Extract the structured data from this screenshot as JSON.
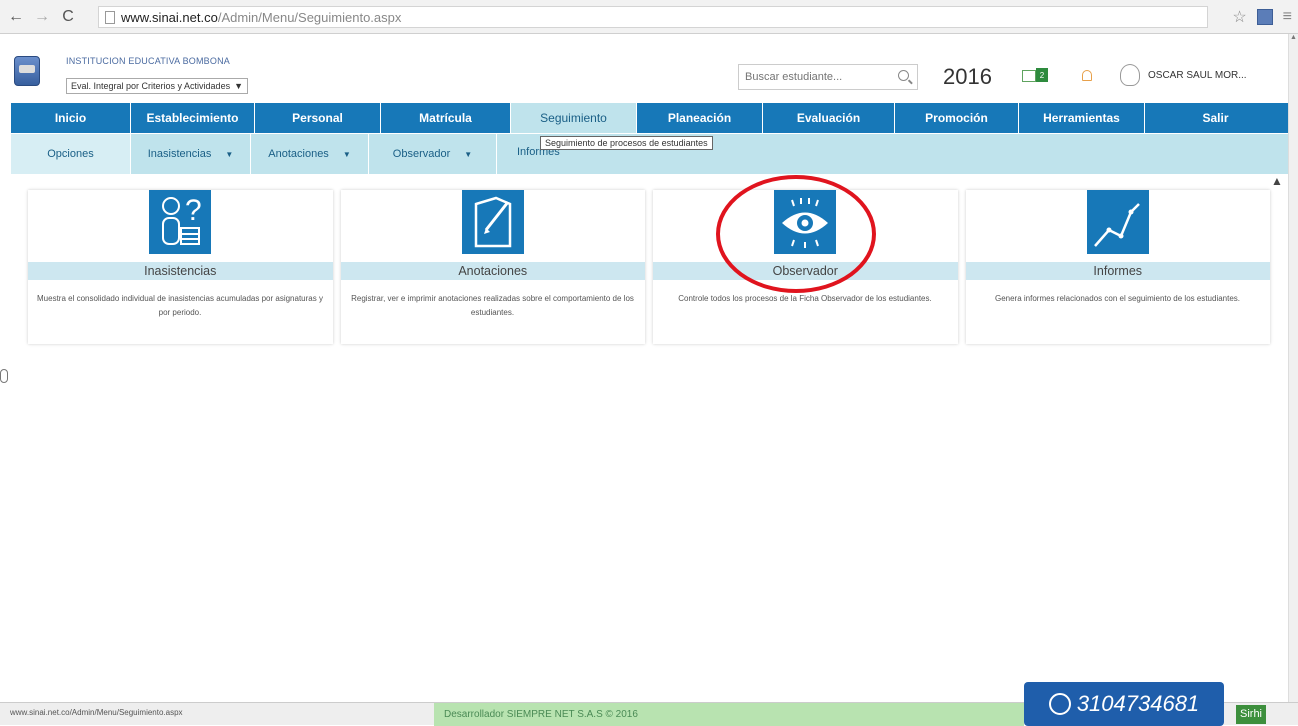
{
  "browser": {
    "url_host": "www.sinai.net.co",
    "url_path": "/Admin/Menu/Seguimiento.aspx"
  },
  "header": {
    "institution": "INSTITUCION EDUCATIVA BOMBONA",
    "eval_select": "Eval. Integral por Criterios y Actividades",
    "search_placeholder": "Buscar estudiante...",
    "year": "2016",
    "messages_count": "2",
    "user": "OSCAR SAUL MOR..."
  },
  "main_menu": [
    {
      "label": "Inicio",
      "width": 120
    },
    {
      "label": "Establecimiento",
      "width": 124
    },
    {
      "label": "Personal",
      "width": 126
    },
    {
      "label": "Matrícula",
      "width": 130
    },
    {
      "label": "Seguimiento",
      "width": 126
    },
    {
      "label": "Planeación",
      "width": 126
    },
    {
      "label": "Evaluación",
      "width": 132
    },
    {
      "label": "Promoción",
      "width": 124
    },
    {
      "label": "Herramientas",
      "width": 126
    },
    {
      "label": "Salir",
      "width": 141
    }
  ],
  "sub_menu": {
    "options": "Opciones",
    "items": [
      "Inasistencias",
      "Anotaciones",
      "Observador",
      "Informes"
    ]
  },
  "tooltip": "Seguimiento de procesos de estudiantes",
  "cards": [
    {
      "title": "Inasistencias",
      "icon": "question-person-icon",
      "desc": "Muestra el consolidado individual de inasistencias acumuladas por asignaturas y por periodo."
    },
    {
      "title": "Anotaciones",
      "icon": "note-pen-icon",
      "desc": "Registrar, ver e imprimir anotaciones realizadas sobre el comportamiento de los estudiantes."
    },
    {
      "title": "Observador",
      "icon": "eye-icon",
      "desc": "Controle todos los procesos de la Ficha Observador de los estudiantes."
    },
    {
      "title": "Informes",
      "icon": "line-chart-icon",
      "desc": "Genera informes relacionados con el seguimiento de los estudiantes."
    }
  ],
  "footer": {
    "status_url": "www.sinai.net.co/Admin/Menu/Seguimiento.aspx",
    "developer": "Desarrollador SIEMPRE NET S.A.S © 2016",
    "phone": "3104734681",
    "sirhi": "Sirhi"
  },
  "colors": {
    "menu_blue": "#1778b8",
    "submenu_bg": "#bfe3ec",
    "annotation_red": "#e0141e"
  }
}
